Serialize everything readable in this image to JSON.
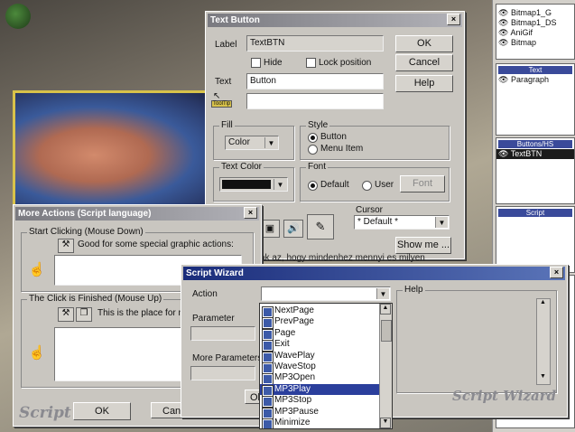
{
  "ribbon": {
    "items": [
      "Bitmap1_G",
      "Bitmap1_DS",
      "AniGif",
      "Bitmap"
    ]
  },
  "props_panels": {
    "text_header": "Text",
    "text_item": "Paragraph",
    "buttons_header": "Buttons/HS",
    "buttons_item": "TextBTN",
    "script_header": "Script"
  },
  "text_button": {
    "title": "Text Button",
    "label_caption": "Label",
    "label_value": "TextBTN",
    "hide": "Hide",
    "lock_position": "Lock position",
    "text_caption": "Text",
    "text_value": "Button",
    "tooltip": "ToolTip",
    "ok": "OK",
    "cancel": "Cancel",
    "help": "Help",
    "fill_group": "Fill",
    "fill_select": "Color",
    "style_group": "Style",
    "style_button": "Button",
    "style_menu_item": "Menu Item",
    "text_color_group": "Text Color",
    "font_group": "Font",
    "font_default": "Default",
    "font_user": "User",
    "font_button": "Font",
    "cursor_caption": "Cursor",
    "cursor_value": "* Default *",
    "show_me": "Show me ..."
  },
  "more_actions": {
    "title": "More Actions (Script language)",
    "start_group": "Start Clicking (Mouse Down)",
    "start_desc": "Good for some special graphic actions:",
    "finish_group": "The Click is Finished (Mouse Up)",
    "finish_desc": "This is the place for mo",
    "ok": "OK",
    "cancel": "Cance",
    "watermark": "Script"
  },
  "background_text": "ak az, hogy mindenhez mennyi es milyen",
  "script_wizard": {
    "title": "Script Wizard",
    "action_caption": "Action",
    "parameter_caption": "Parameter",
    "more_parameters_caption": "More Parameters:",
    "ok_partial": "Ol",
    "help_caption": "Help",
    "watermark": "Script Wizard",
    "actions": [
      "NextPage",
      "PrevPage",
      "Page",
      "Exit",
      "WavePlay",
      "WaveStop",
      "MP3Open",
      "MP3Play",
      "MP3Stop",
      "MP3Pause",
      "Minimize"
    ],
    "selected_action": "MP3Play"
  }
}
